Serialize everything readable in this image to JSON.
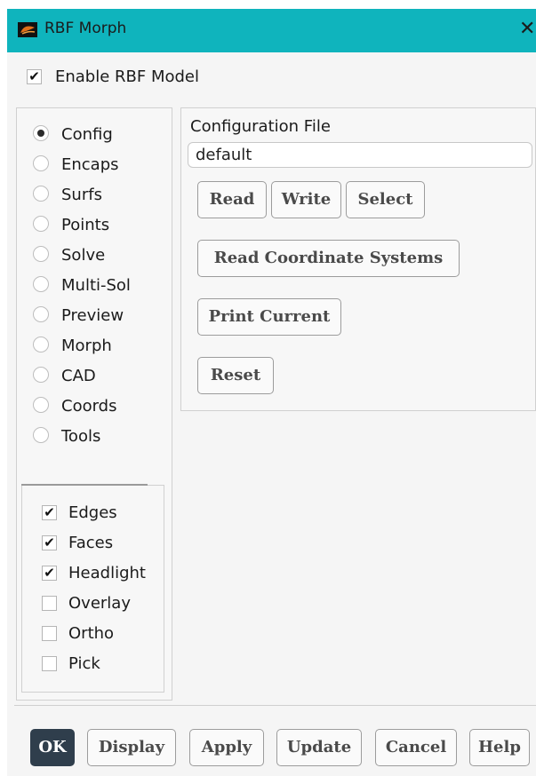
{
  "window": {
    "title": "RBF Morph",
    "close_glyph": "✕",
    "icon": "rbf-morph-app-icon"
  },
  "enable_rbf": {
    "label": "Enable RBF Model",
    "checked": true
  },
  "nav": {
    "options": [
      {
        "label": "Config",
        "selected": true
      },
      {
        "label": "Encaps",
        "selected": false
      },
      {
        "label": "Surfs",
        "selected": false
      },
      {
        "label": "Points",
        "selected": false
      },
      {
        "label": "Solve",
        "selected": false
      },
      {
        "label": "Multi-Sol",
        "selected": false
      },
      {
        "label": "Preview",
        "selected": false
      },
      {
        "label": "Morph",
        "selected": false
      },
      {
        "label": "CAD",
        "selected": false
      },
      {
        "label": "Coords",
        "selected": false
      },
      {
        "label": "Tools",
        "selected": false
      }
    ]
  },
  "display_options": [
    {
      "label": "Edges",
      "checked": true
    },
    {
      "label": "Faces",
      "checked": true
    },
    {
      "label": "Headlight",
      "checked": true
    },
    {
      "label": "Overlay",
      "checked": false
    },
    {
      "label": "Ortho",
      "checked": false
    },
    {
      "label": "Pick",
      "checked": false
    }
  ],
  "config": {
    "file_label": "Configuration File",
    "file_value": "default",
    "read": "Read",
    "write": "Write",
    "select": "Select",
    "read_coords": "Read Coordinate Systems",
    "print_current": "Print Current",
    "reset": "Reset"
  },
  "footer": {
    "ok": "OK",
    "display": "Display",
    "apply": "Apply",
    "update": "Update",
    "cancel": "Cancel",
    "help": "Help"
  },
  "colors": {
    "titlebar": "#0fb4bd",
    "primary_button": "#2f3e4c"
  }
}
